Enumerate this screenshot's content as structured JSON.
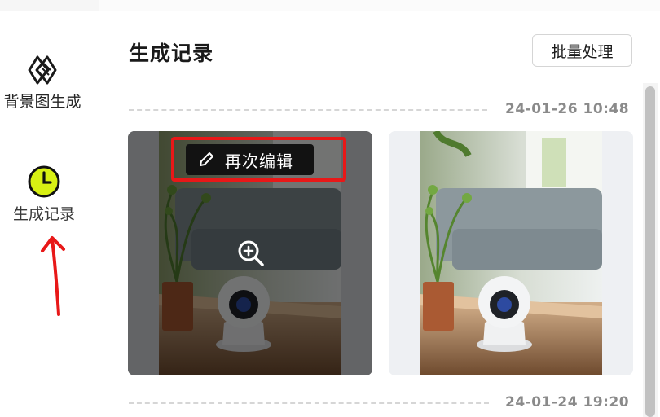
{
  "sidebar": {
    "items": [
      {
        "label": "背景图生成",
        "icon": "bg-generate-icon"
      },
      {
        "label": "生成记录",
        "icon": "clock-icon"
      }
    ]
  },
  "main": {
    "title": "生成记录",
    "batch_button": "批量处理",
    "groups": [
      {
        "date": "24-01-26 10:48",
        "cards": [
          {
            "overlay_label": "再次编辑",
            "hovered": true,
            "zoom_icon": "zoom-in-icon"
          },
          {
            "hovered": false
          }
        ]
      },
      {
        "date": "24-01-24 19:20",
        "cards": []
      }
    ]
  },
  "colors": {
    "accent": "#d8f013",
    "annotation": "#e81818"
  }
}
